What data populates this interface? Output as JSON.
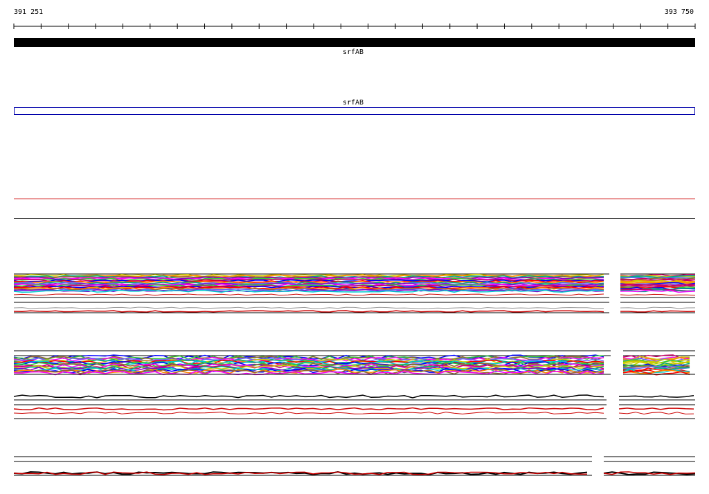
{
  "ruler": {
    "start_label": "391 251",
    "end_label": "393 750"
  },
  "genes": [
    {
      "track": "coding",
      "label": "srfAB"
    },
    {
      "track": "annotation",
      "label": "srfAB"
    }
  ],
  "colors": {
    "gene_fill": "#000000",
    "annotation_border": "#0000aa",
    "reference_line": "#cc0000",
    "baseline": "#000000",
    "palette": [
      "#ff00ff",
      "#00cccc",
      "#33cc33",
      "#ff8800",
      "#0000ff",
      "#cccc00",
      "#ff0000",
      "#8800cc",
      "#00aa88",
      "#996633",
      "#6666ff",
      "#cc0066"
    ]
  }
}
